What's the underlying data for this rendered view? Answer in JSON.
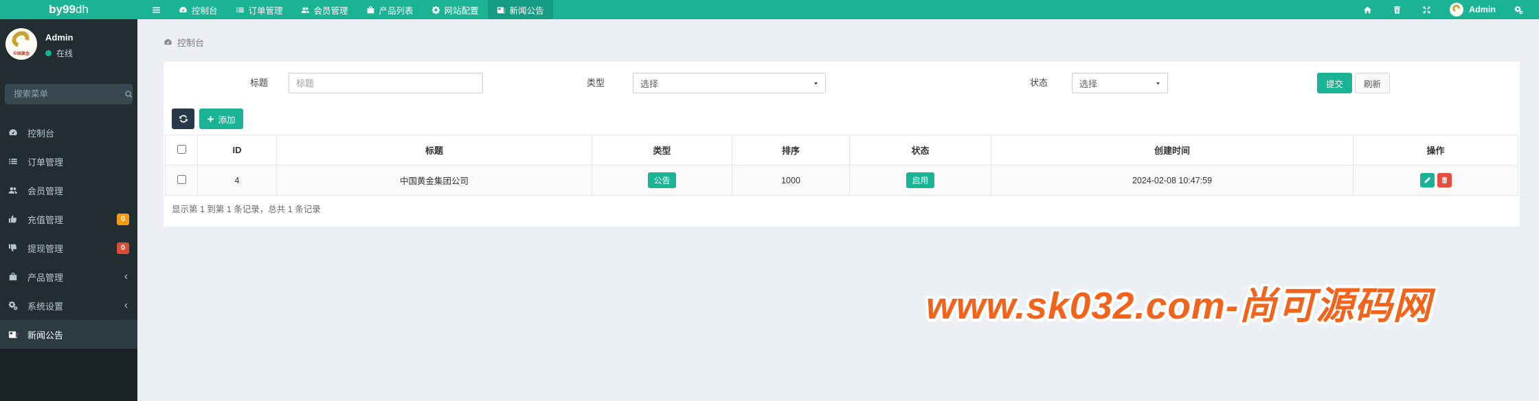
{
  "brand": {
    "bold": "by99",
    "light": "dh"
  },
  "navbar": {
    "menu_icon": "menu-icon",
    "items": [
      {
        "name": "dashboard",
        "label": "控制台",
        "icon": "dashboard-icon",
        "active": false
      },
      {
        "name": "orders",
        "label": "订单管理",
        "icon": "list-icon",
        "active": false
      },
      {
        "name": "members",
        "label": "会员管理",
        "icon": "users-icon",
        "active": false
      },
      {
        "name": "products",
        "label": "产品列表",
        "icon": "bag-icon",
        "active": false
      },
      {
        "name": "site-config",
        "label": "网站配置",
        "icon": "gear-icon",
        "active": false
      },
      {
        "name": "news",
        "label": "新闻公告",
        "icon": "newspaper-icon",
        "active": true
      }
    ],
    "right_icons": [
      {
        "name": "home",
        "icon": "home-icon"
      },
      {
        "name": "trash",
        "icon": "trash-icon"
      },
      {
        "name": "expand",
        "icon": "expand-icon"
      }
    ],
    "user": {
      "label": "Admin"
    },
    "settings_icon": "cogs-icon"
  },
  "sidebar": {
    "user": {
      "name": "Admin",
      "status": "在线",
      "avatar_text": "中国黄金"
    },
    "search_placeholder": "搜索菜单",
    "items": [
      {
        "name": "dashboard",
        "label": "控制台",
        "icon": "dashboard-icon"
      },
      {
        "name": "orders",
        "label": "订单管理",
        "icon": "list-icon"
      },
      {
        "name": "members",
        "label": "会员管理",
        "icon": "users-icon"
      },
      {
        "name": "recharge",
        "label": "充值管理",
        "icon": "thumbs-up-icon",
        "badge": "0",
        "badge_color": "#f39c12"
      },
      {
        "name": "withdraw",
        "label": "提现管理",
        "icon": "thumbs-down-icon",
        "badge": "0",
        "badge_color": "#dd4b39"
      },
      {
        "name": "product-mgmt",
        "label": "产品管理",
        "icon": "bag-icon",
        "chevron": true
      },
      {
        "name": "system",
        "label": "系统设置",
        "icon": "cogs-icon",
        "chevron": true
      },
      {
        "name": "news",
        "label": "新闻公告",
        "icon": "newspaper-icon",
        "active": true
      }
    ]
  },
  "breadcrumb": {
    "label": "控制台",
    "icon": "dashboard-icon"
  },
  "filter": {
    "title_label": "标题",
    "title_placeholder": "标题",
    "title_value": "",
    "type_label": "类型",
    "type_value": "选择",
    "status_label": "状态",
    "status_value": "选择",
    "submit_label": "提交",
    "refresh_label": "刷新"
  },
  "toolbar": {
    "add_label": "添加"
  },
  "table": {
    "headers": [
      "ID",
      "标题",
      "类型",
      "排序",
      "状态",
      "创建时间",
      "操作"
    ],
    "rows": [
      {
        "id": "4",
        "title": "中国黄金集团公司",
        "type": "公告",
        "sort": "1000",
        "status": "启用",
        "created": "2024-02-08 10:47:59"
      }
    ]
  },
  "pagination": {
    "summary": "显示第 1 到第 1 条记录，总共 1 条记录"
  },
  "watermark": "www.sk032.com-尚可源码网",
  "colors": {
    "primary": "#1ab394",
    "badge_orange": "#f39c12",
    "badge_red": "#dd4b39",
    "edit_green": "#1ab394",
    "delete_red": "#e74c3c"
  }
}
